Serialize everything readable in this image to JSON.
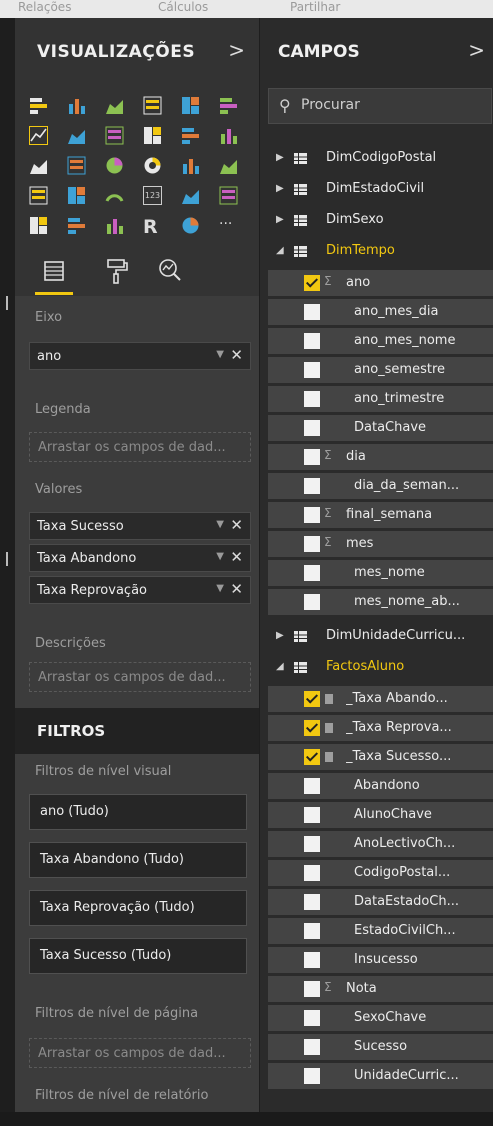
{
  "top_strip": [
    "Relações",
    "Cálculos",
    "Partilhar"
  ],
  "visualizations": {
    "title": "VISUALIZAÇÕES",
    "chevron": ">",
    "icons": [
      "stacked-bar-icon",
      "stacked-column-icon",
      "clustered-bar-icon",
      "clustered-column-icon",
      "100-bar-icon",
      "100-column-icon",
      "line-chart-icon",
      "area-chart-icon",
      "stacked-area-icon",
      "line-column-icon",
      "line-clustered-icon",
      "ribbon-chart-icon",
      "waterfall-icon",
      "scatter-icon",
      "pie-icon",
      "donut-icon",
      "treemap-icon",
      "map-icon",
      "filled-map-icon",
      "funnel-icon",
      "gauge-icon",
      "card-icon",
      "multirow-card-icon",
      "kpi-icon",
      "slicer-icon",
      "table-icon",
      "matrix-icon",
      "r-script-icon",
      "globe-icon",
      "more-icon"
    ],
    "more_label": "···",
    "r_label": "R",
    "card_label": "123"
  },
  "tabs": [
    "fields-tab",
    "format-tab",
    "analytics-tab"
  ],
  "wells": {
    "axis_label": "Eixo",
    "axis_field": "ano",
    "legend_label": "Legenda",
    "legend_placeholder": "Arrastar os campos de dad...",
    "values_label": "Valores",
    "values_fields": [
      "Taxa Sucesso",
      "Taxa Abandono",
      "Taxa Reprovação"
    ],
    "tooltips_label": "Descrições",
    "tooltips_placeholder": "Arrastar os campos de dad..."
  },
  "filters": {
    "title": "FILTROS",
    "visual_level_label": "Filtros de nível visual",
    "visual_filters": [
      "ano (Tudo)",
      "Taxa Abandono (Tudo)",
      "Taxa Reprovação (Tudo)",
      "Taxa Sucesso (Tudo)"
    ],
    "page_level_label": "Filtros de nível de página",
    "page_placeholder": "Arrastar os campos de dad...",
    "report_level_label": "Filtros de nível de relatório"
  },
  "fields": {
    "title": "CAMPOS",
    "chevron": ">",
    "search_placeholder": "Procurar",
    "tables_top": [
      "DimCodigoPostal",
      "DimEstadoCivil",
      "DimSexo"
    ],
    "dimtempo": {
      "name": "DimTempo",
      "fields": [
        {
          "name": "ano",
          "checked": true,
          "sigma": true
        },
        {
          "name": "ano_mes_dia",
          "checked": false,
          "sigma": false
        },
        {
          "name": "ano_mes_nome",
          "checked": false,
          "sigma": false
        },
        {
          "name": "ano_semestre",
          "checked": false,
          "sigma": false
        },
        {
          "name": "ano_trimestre",
          "checked": false,
          "sigma": false
        },
        {
          "name": "DataChave",
          "checked": false,
          "sigma": false
        },
        {
          "name": "dia",
          "checked": false,
          "sigma": true
        },
        {
          "name": "dia_da_seman...",
          "checked": false,
          "sigma": false
        },
        {
          "name": "final_semana",
          "checked": false,
          "sigma": true
        },
        {
          "name": "mes",
          "checked": false,
          "sigma": true
        },
        {
          "name": "mes_nome",
          "checked": false,
          "sigma": false
        },
        {
          "name": "mes_nome_ab...",
          "checked": false,
          "sigma": false
        }
      ]
    },
    "dimunidade": "DimUnidadeCurricu...",
    "factos": {
      "name": "FactosAluno",
      "fields": [
        {
          "name": "_Taxa Abando...",
          "checked": true,
          "calc": true
        },
        {
          "name": "_Taxa Reprova...",
          "checked": true,
          "calc": true
        },
        {
          "name": "_Taxa Sucesso...",
          "checked": true,
          "calc": true
        },
        {
          "name": "Abandono",
          "checked": false
        },
        {
          "name": "AlunoChave",
          "checked": false
        },
        {
          "name": "AnoLectivoCh...",
          "checked": false
        },
        {
          "name": "CodigoPostal...",
          "checked": false
        },
        {
          "name": "DataEstadoCh...",
          "checked": false
        },
        {
          "name": "EstadoCivilCh...",
          "checked": false
        },
        {
          "name": "Insucesso",
          "checked": false
        },
        {
          "name": "Nota",
          "checked": false,
          "sigma": true
        },
        {
          "name": "SexoChave",
          "checked": false
        },
        {
          "name": "Sucesso",
          "checked": false
        },
        {
          "name": "UnidadeCurric...",
          "checked": false
        }
      ]
    }
  },
  "colors": {
    "accent": "#f2c811",
    "panel": "#333333",
    "well": "#3c3c3c",
    "fields_bg": "#2b2b2b",
    "row_bg": "#444444"
  }
}
